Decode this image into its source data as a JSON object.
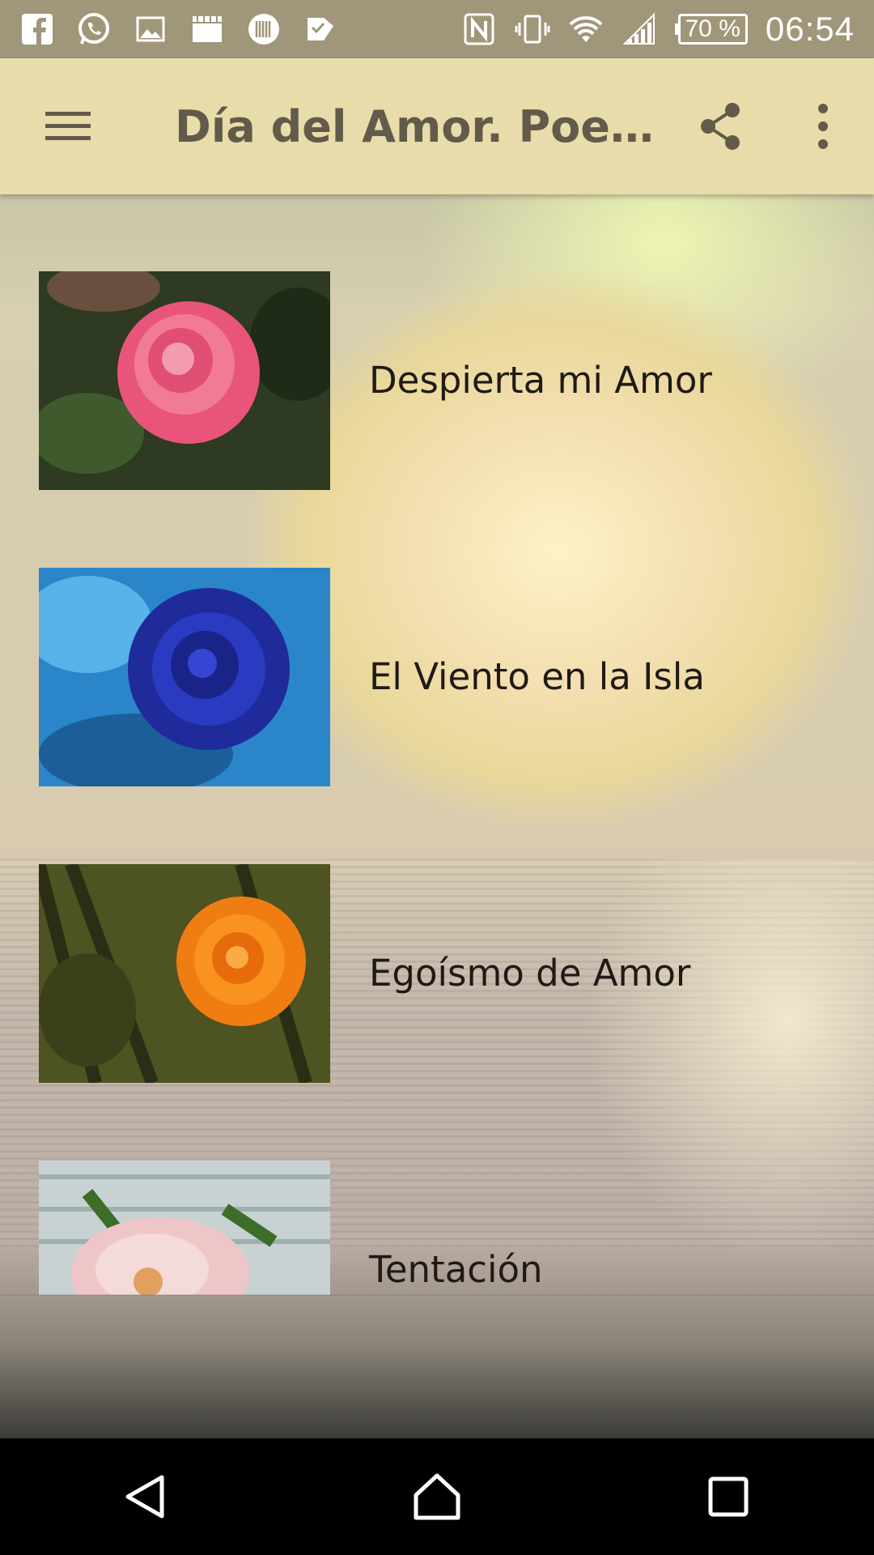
{
  "status_bar": {
    "left_icons": [
      "facebook-icon",
      "whatsapp-icon",
      "gallery-icon",
      "clapperboard-icon",
      "barcode-icon",
      "check-mail-icon"
    ],
    "right_icons": [
      "nfc-icon",
      "vibrate-icon",
      "wifi-icon",
      "signal-icon"
    ],
    "battery": "70 %",
    "time": "06:54"
  },
  "app_bar": {
    "title": "Día del Amor. Poem…",
    "menu_icon": "hamburger-menu-icon",
    "share_icon": "share-icon",
    "overflow_icon": "more-vert-icon",
    "background_color": "#e8dcaa",
    "title_color": "#625a4a"
  },
  "poems": [
    {
      "title": "Despierta mi Amor",
      "thumbnail": "pink-rose"
    },
    {
      "title": "El Viento en la Isla",
      "thumbnail": "blue-rose"
    },
    {
      "title": "Egoísmo de Amor",
      "thumbnail": "orange-rose"
    },
    {
      "title": "Tentación",
      "thumbnail": "white-pink-rose"
    }
  ],
  "nav_bar": {
    "back_icon": "back-triangle-icon",
    "home_icon": "home-icon",
    "recents_icon": "recents-square-icon"
  }
}
